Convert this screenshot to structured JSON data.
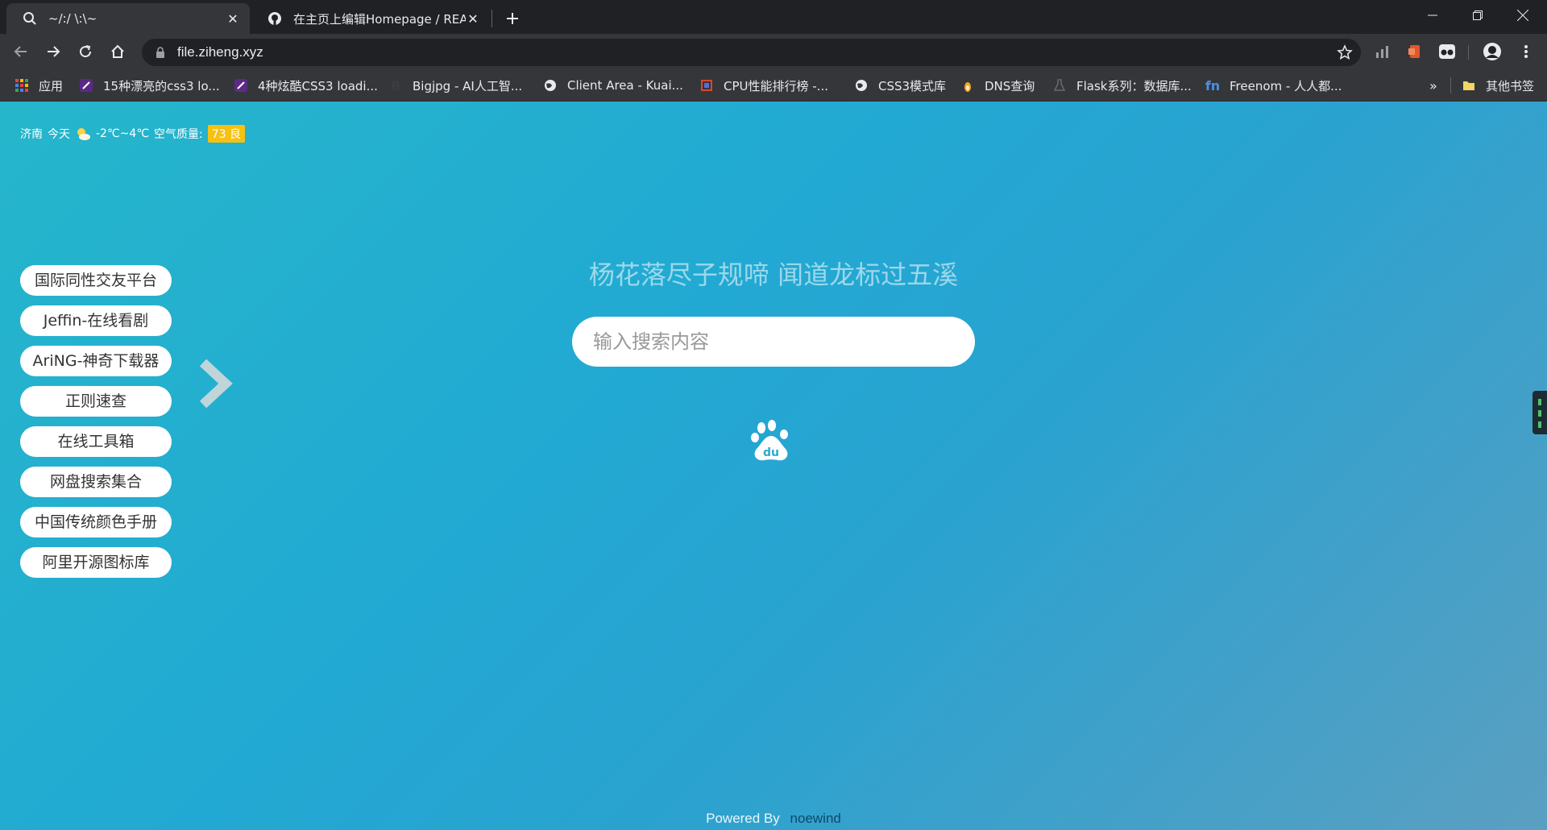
{
  "tabs": [
    {
      "title": "~/:/ \\:\\~",
      "icon": "search-icon",
      "active": true
    },
    {
      "title": "在主页上编辑Homepage / REAI",
      "icon": "github-icon",
      "active": false
    }
  ],
  "omnibox": {
    "url": "file.ziheng.xyz"
  },
  "bookmarks": {
    "items": [
      {
        "label": "应用",
        "icon": "apps-grid-icon"
      },
      {
        "label": "15种漂亮的css3 lo...",
        "icon": "feather-icon"
      },
      {
        "label": "4种炫酷CSS3 loadi...",
        "icon": "feather-icon"
      },
      {
        "label": "Bigjpg - AI人工智...",
        "icon": "letter-b-icon"
      },
      {
        "label": "Client Area - Kuai...",
        "icon": "globe-icon"
      },
      {
        "label": "CPU性能排行榜 -...",
        "icon": "cpu-icon"
      },
      {
        "label": "CSS3模式库",
        "icon": "globe-icon"
      },
      {
        "label": "DNS查询",
        "icon": "flame-icon"
      },
      {
        "label": "Flask系列：数据库...",
        "icon": "flask-icon"
      },
      {
        "label": "Freenom - 人人都...",
        "icon": "freenom-icon"
      }
    ],
    "overflow": "»",
    "other": "其他书签"
  },
  "weather": {
    "city": "济南",
    "day": "今天",
    "temp": "-2℃~4℃",
    "aqi_label": "空气质量:",
    "aqi_value": "73 良"
  },
  "sidebar": {
    "links": [
      "国际同性交友平台",
      "Jeffin-在线看剧",
      "AriNG-神奇下载器",
      "正则速查",
      "在线工具箱",
      "网盘搜索集合",
      "中国传统颜色手册",
      "阿里开源图标库"
    ]
  },
  "main": {
    "poem": "杨花落尽子规啼 闻道龙标过五溪",
    "search_placeholder": "输入搜索内容",
    "engine": "baidu-icon"
  },
  "footer": {
    "powered": "Powered By",
    "author": "noewind"
  },
  "colors": {
    "aqi": "#f7c112",
    "page_bg_start": "#25b6cb",
    "page_bg_end": "#5a9fc1"
  }
}
